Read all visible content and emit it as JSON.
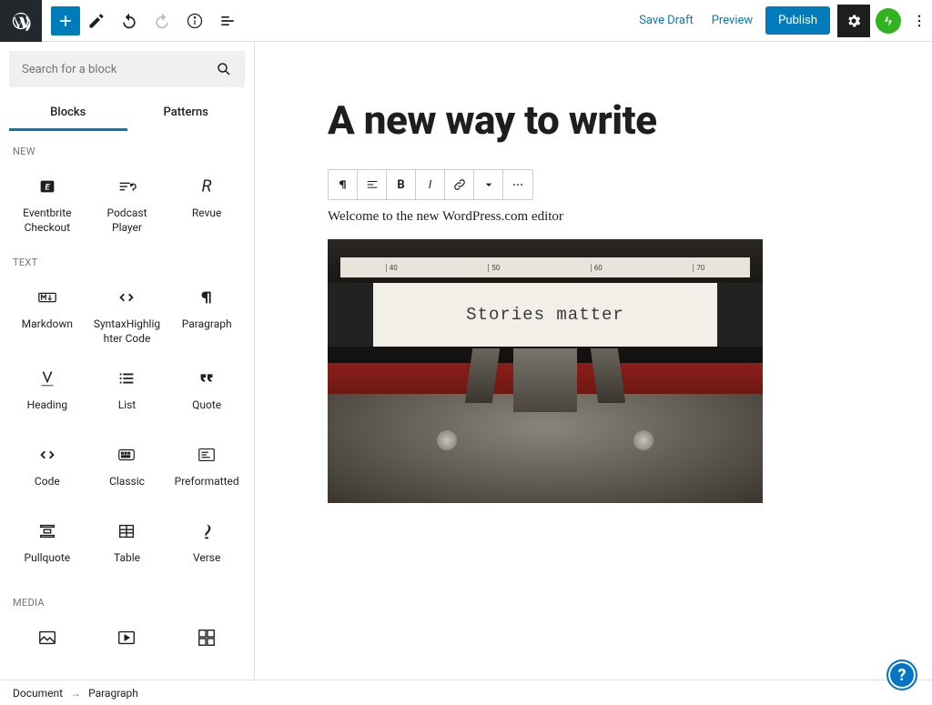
{
  "topbar": {
    "save_draft": "Save Draft",
    "preview": "Preview",
    "publish": "Publish"
  },
  "search": {
    "placeholder": "Search for a block"
  },
  "tabs": {
    "blocks": "Blocks",
    "patterns": "Patterns"
  },
  "categories": {
    "new": "NEW",
    "text": "TEXT",
    "media": "MEDIA"
  },
  "blocks": {
    "eventbrite": "Eventbrite Checkout",
    "podcast": "Podcast Player",
    "revue": "Revue",
    "markdown": "Markdown",
    "syntax": "SyntaxHighlighter Code",
    "paragraph": "Paragraph",
    "heading": "Heading",
    "list": "List",
    "quote": "Quote",
    "code": "Code",
    "classic": "Classic",
    "preformatted": "Preformatted",
    "pullquote": "Pullquote",
    "table": "Table",
    "verse": "Verse"
  },
  "editor": {
    "title": "A new way to write",
    "paragraph": "Welcome to the new WordPress.com editor",
    "image_text": "Stories matter",
    "ruler_marks": [
      "40",
      "50",
      "60",
      "70"
    ]
  },
  "breadcrumb": {
    "document": "Document",
    "paragraph": "Paragraph"
  }
}
